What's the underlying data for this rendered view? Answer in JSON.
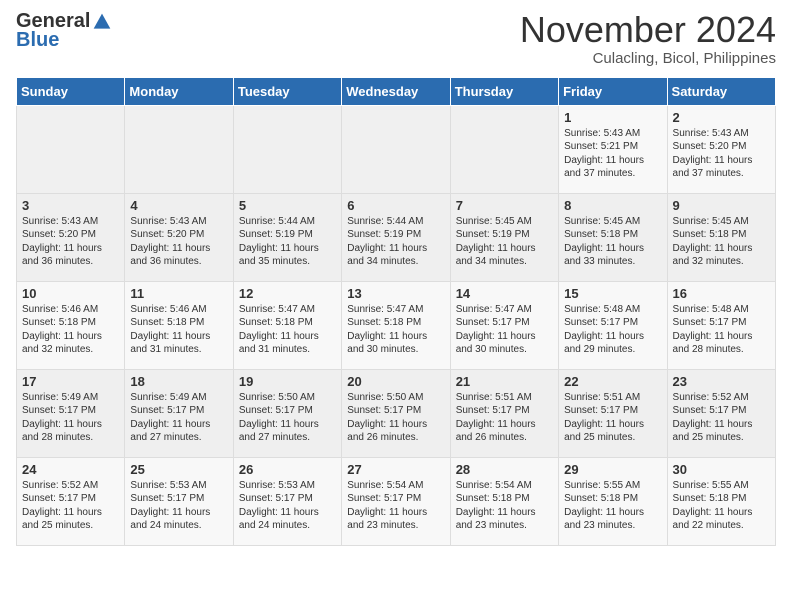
{
  "header": {
    "logo_general": "General",
    "logo_blue": "Blue",
    "month": "November 2024",
    "location": "Culacling, Bicol, Philippines"
  },
  "days_of_week": [
    "Sunday",
    "Monday",
    "Tuesday",
    "Wednesday",
    "Thursday",
    "Friday",
    "Saturday"
  ],
  "weeks": [
    [
      {
        "day": "",
        "info": ""
      },
      {
        "day": "",
        "info": ""
      },
      {
        "day": "",
        "info": ""
      },
      {
        "day": "",
        "info": ""
      },
      {
        "day": "",
        "info": ""
      },
      {
        "day": "1",
        "info": "Sunrise: 5:43 AM\nSunset: 5:21 PM\nDaylight: 11 hours and 37 minutes."
      },
      {
        "day": "2",
        "info": "Sunrise: 5:43 AM\nSunset: 5:20 PM\nDaylight: 11 hours and 37 minutes."
      }
    ],
    [
      {
        "day": "3",
        "info": "Sunrise: 5:43 AM\nSunset: 5:20 PM\nDaylight: 11 hours and 36 minutes."
      },
      {
        "day": "4",
        "info": "Sunrise: 5:43 AM\nSunset: 5:20 PM\nDaylight: 11 hours and 36 minutes."
      },
      {
        "day": "5",
        "info": "Sunrise: 5:44 AM\nSunset: 5:19 PM\nDaylight: 11 hours and 35 minutes."
      },
      {
        "day": "6",
        "info": "Sunrise: 5:44 AM\nSunset: 5:19 PM\nDaylight: 11 hours and 34 minutes."
      },
      {
        "day": "7",
        "info": "Sunrise: 5:45 AM\nSunset: 5:19 PM\nDaylight: 11 hours and 34 minutes."
      },
      {
        "day": "8",
        "info": "Sunrise: 5:45 AM\nSunset: 5:18 PM\nDaylight: 11 hours and 33 minutes."
      },
      {
        "day": "9",
        "info": "Sunrise: 5:45 AM\nSunset: 5:18 PM\nDaylight: 11 hours and 32 minutes."
      }
    ],
    [
      {
        "day": "10",
        "info": "Sunrise: 5:46 AM\nSunset: 5:18 PM\nDaylight: 11 hours and 32 minutes."
      },
      {
        "day": "11",
        "info": "Sunrise: 5:46 AM\nSunset: 5:18 PM\nDaylight: 11 hours and 31 minutes."
      },
      {
        "day": "12",
        "info": "Sunrise: 5:47 AM\nSunset: 5:18 PM\nDaylight: 11 hours and 31 minutes."
      },
      {
        "day": "13",
        "info": "Sunrise: 5:47 AM\nSunset: 5:18 PM\nDaylight: 11 hours and 30 minutes."
      },
      {
        "day": "14",
        "info": "Sunrise: 5:47 AM\nSunset: 5:17 PM\nDaylight: 11 hours and 30 minutes."
      },
      {
        "day": "15",
        "info": "Sunrise: 5:48 AM\nSunset: 5:17 PM\nDaylight: 11 hours and 29 minutes."
      },
      {
        "day": "16",
        "info": "Sunrise: 5:48 AM\nSunset: 5:17 PM\nDaylight: 11 hours and 28 minutes."
      }
    ],
    [
      {
        "day": "17",
        "info": "Sunrise: 5:49 AM\nSunset: 5:17 PM\nDaylight: 11 hours and 28 minutes."
      },
      {
        "day": "18",
        "info": "Sunrise: 5:49 AM\nSunset: 5:17 PM\nDaylight: 11 hours and 27 minutes."
      },
      {
        "day": "19",
        "info": "Sunrise: 5:50 AM\nSunset: 5:17 PM\nDaylight: 11 hours and 27 minutes."
      },
      {
        "day": "20",
        "info": "Sunrise: 5:50 AM\nSunset: 5:17 PM\nDaylight: 11 hours and 26 minutes."
      },
      {
        "day": "21",
        "info": "Sunrise: 5:51 AM\nSunset: 5:17 PM\nDaylight: 11 hours and 26 minutes."
      },
      {
        "day": "22",
        "info": "Sunrise: 5:51 AM\nSunset: 5:17 PM\nDaylight: 11 hours and 25 minutes."
      },
      {
        "day": "23",
        "info": "Sunrise: 5:52 AM\nSunset: 5:17 PM\nDaylight: 11 hours and 25 minutes."
      }
    ],
    [
      {
        "day": "24",
        "info": "Sunrise: 5:52 AM\nSunset: 5:17 PM\nDaylight: 11 hours and 25 minutes."
      },
      {
        "day": "25",
        "info": "Sunrise: 5:53 AM\nSunset: 5:17 PM\nDaylight: 11 hours and 24 minutes."
      },
      {
        "day": "26",
        "info": "Sunrise: 5:53 AM\nSunset: 5:17 PM\nDaylight: 11 hours and 24 minutes."
      },
      {
        "day": "27",
        "info": "Sunrise: 5:54 AM\nSunset: 5:17 PM\nDaylight: 11 hours and 23 minutes."
      },
      {
        "day": "28",
        "info": "Sunrise: 5:54 AM\nSunset: 5:18 PM\nDaylight: 11 hours and 23 minutes."
      },
      {
        "day": "29",
        "info": "Sunrise: 5:55 AM\nSunset: 5:18 PM\nDaylight: 11 hours and 23 minutes."
      },
      {
        "day": "30",
        "info": "Sunrise: 5:55 AM\nSunset: 5:18 PM\nDaylight: 11 hours and 22 minutes."
      }
    ]
  ]
}
